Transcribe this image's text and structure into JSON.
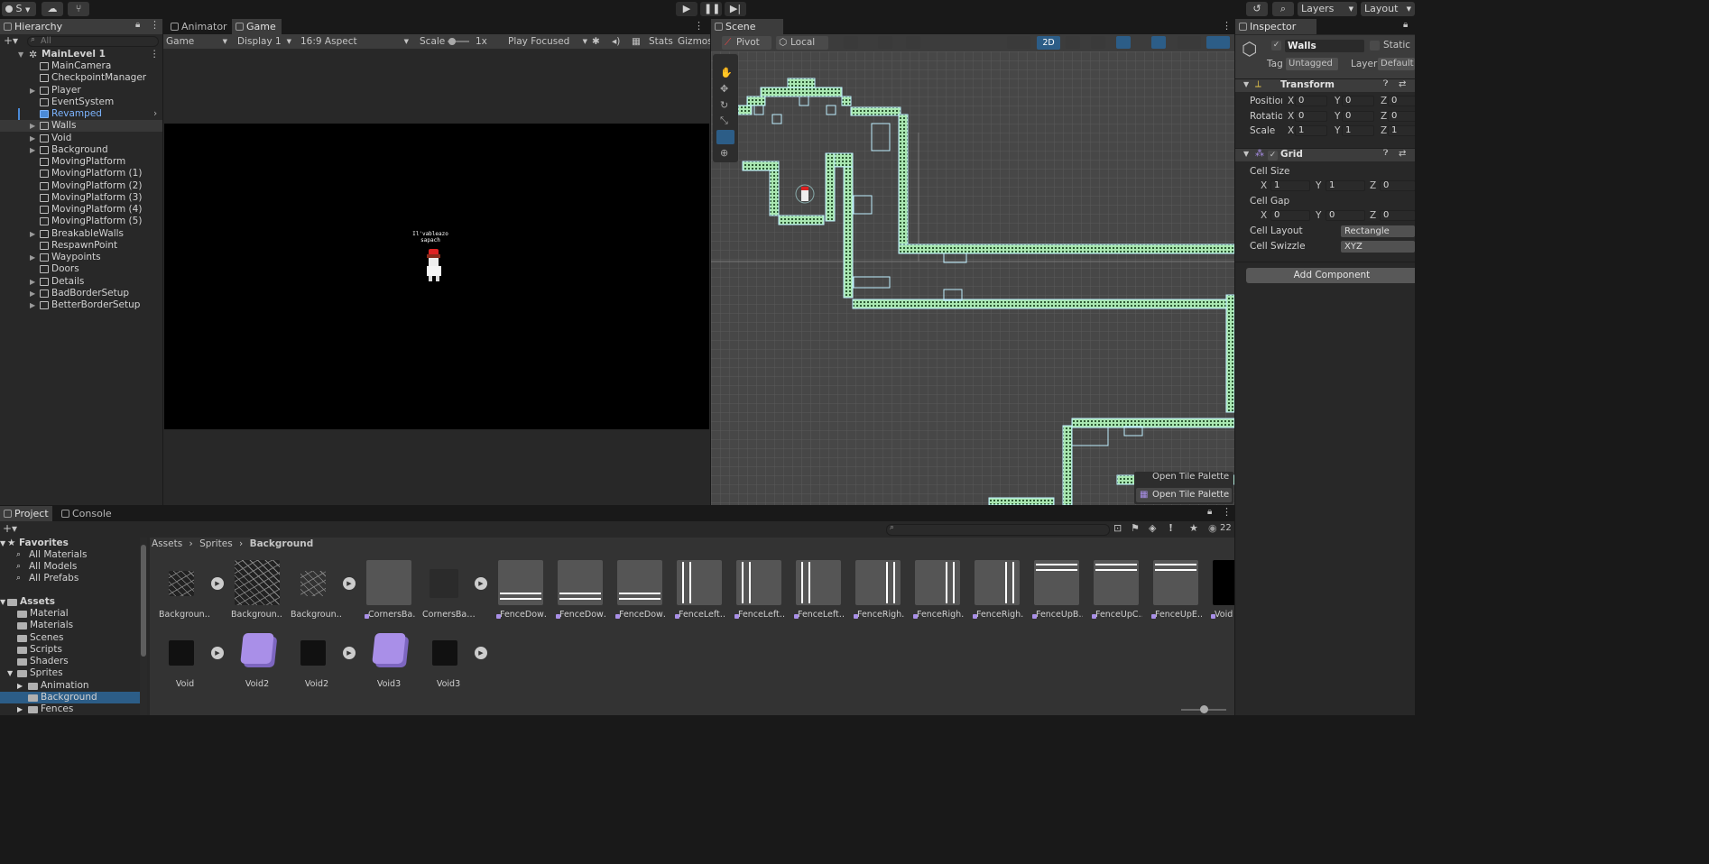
{
  "toolbar": {
    "account_label": "S",
    "layers_label": "Layers",
    "layout_label": "Layout"
  },
  "hierarchy": {
    "tab_label": "Hierarchy",
    "search_placeholder": "All",
    "scene_name": "MainLevel 1",
    "items": [
      {
        "label": "MainCamera",
        "expandable": false,
        "prefab": false
      },
      {
        "label": "CheckpointManager",
        "expandable": false,
        "prefab": false
      },
      {
        "label": "Player",
        "expandable": true,
        "prefab": false
      },
      {
        "label": "EventSystem",
        "expandable": false,
        "prefab": false
      },
      {
        "label": "Revamped",
        "expandable": false,
        "prefab": true
      },
      {
        "label": "Walls",
        "expandable": true,
        "prefab": false,
        "selected": true
      },
      {
        "label": "Void",
        "expandable": true,
        "prefab": false
      },
      {
        "label": "Background",
        "expandable": true,
        "prefab": false
      },
      {
        "label": "MovingPlatform",
        "expandable": false,
        "prefab": false
      },
      {
        "label": "MovingPlatform (1)",
        "expandable": false,
        "prefab": false
      },
      {
        "label": "MovingPlatform (2)",
        "expandable": false,
        "prefab": false
      },
      {
        "label": "MovingPlatform (3)",
        "expandable": false,
        "prefab": false
      },
      {
        "label": "MovingPlatform (4)",
        "expandable": false,
        "prefab": false
      },
      {
        "label": "MovingPlatform (5)",
        "expandable": false,
        "prefab": false
      },
      {
        "label": "BreakableWalls",
        "expandable": true,
        "prefab": false
      },
      {
        "label": "RespawnPoint",
        "expandable": false,
        "prefab": false
      },
      {
        "label": "Waypoints",
        "expandable": true,
        "prefab": false
      },
      {
        "label": "Doors",
        "expandable": false,
        "prefab": false
      },
      {
        "label": "Details",
        "expandable": true,
        "prefab": false
      },
      {
        "label": "BadBorderSetup",
        "expandable": true,
        "prefab": false
      },
      {
        "label": "BetterBorderSetup",
        "expandable": true,
        "prefab": false
      }
    ]
  },
  "game_view": {
    "tabs": [
      "Animator",
      "Game"
    ],
    "mode": "Game",
    "display": "Display 1",
    "aspect": "16:9 Aspect",
    "scale_label": "Scale",
    "scale_value": "1x",
    "play_mode": "Play Focused",
    "stats_label": "Stats",
    "gizmos_label": "Gizmos",
    "speech_text": "Il'vableazo sapach"
  },
  "scene_view": {
    "tab_label": "Scene",
    "pivot_label": "Pivot",
    "local_label": "Local",
    "mode_2d": "2D",
    "open_tile_palette": "Open Tile Palette"
  },
  "inspector": {
    "tab_label": "Inspector",
    "object_name": "Walls",
    "static_label": "Static",
    "tag_label": "Tag",
    "tag_value": "Untagged",
    "layer_label": "Layer",
    "layer_value": "Default",
    "transform": {
      "title": "Transform",
      "position_label": "Position",
      "rotation_label": "Rotation",
      "scale_label": "Scale",
      "position": [
        "0",
        "0",
        "0"
      ],
      "rotation": [
        "0",
        "0",
        "0"
      ],
      "scale": [
        "1",
        "1",
        "1"
      ]
    },
    "grid": {
      "title": "Grid",
      "cell_size_label": "Cell Size",
      "cell_size": [
        "1",
        "1",
        "0"
      ],
      "cell_gap_label": "Cell Gap",
      "cell_gap": [
        "0",
        "0",
        "0"
      ],
      "cell_layout_label": "Cell Layout",
      "cell_layout_value": "Rectangle",
      "cell_swizzle_label": "Cell Swizzle",
      "cell_swizzle_value": "XYZ"
    },
    "add_component_label": "Add Component"
  },
  "project": {
    "tabs": [
      "Project",
      "Console"
    ],
    "count": "22",
    "favorites_label": "Favorites",
    "favorites": [
      "All Materials",
      "All Models",
      "All Prefabs"
    ],
    "assets_label": "Assets",
    "folders": [
      "Material",
      "Materials",
      "Scenes",
      "Scripts",
      "Shaders",
      "Sprites"
    ],
    "sprite_folders": [
      "Animation",
      "Background",
      "Fences"
    ],
    "breadcrumb": [
      "Assets",
      "Sprites",
      "Background"
    ],
    "row1": [
      {
        "name": "Backgroun…",
        "kind": "cracks-small",
        "play": true
      },
      {
        "name": "Backgroun…",
        "kind": "cracks-large",
        "play": false
      },
      {
        "name": "Backgroun…",
        "kind": "cracks-white",
        "play": true
      },
      {
        "name": "CornersBa…",
        "kind": "plain",
        "play": false
      },
      {
        "name": "CornersBa…",
        "kind": "dark",
        "play": true
      },
      {
        "name": "FenceDow…",
        "kind": "fence-bl",
        "play": false
      },
      {
        "name": "FenceDow…",
        "kind": "fence-b",
        "play": false
      },
      {
        "name": "FenceDow…",
        "kind": "fence-br",
        "play": false
      },
      {
        "name": "FenceLeft…",
        "kind": "fence-l",
        "play": false
      },
      {
        "name": "FenceLeft…",
        "kind": "fence-l2",
        "play": false
      },
      {
        "name": "FenceLeft…",
        "kind": "fence-lt",
        "play": false
      },
      {
        "name": "FenceRigh…",
        "kind": "fence-rt",
        "play": false
      },
      {
        "name": "FenceRigh…",
        "kind": "fence-r",
        "play": false
      },
      {
        "name": "FenceRigh…",
        "kind": "fence-rb",
        "play": false
      },
      {
        "name": "FenceUpB…",
        "kind": "fence-tl",
        "play": false
      },
      {
        "name": "FenceUpC…",
        "kind": "fence-t",
        "play": false
      },
      {
        "name": "FenceUpE…",
        "kind": "fence-tr",
        "play": false
      },
      {
        "name": "Void",
        "kind": "black",
        "play": false
      }
    ],
    "row2": [
      {
        "name": "Void",
        "kind": "black-small",
        "play": true
      },
      {
        "name": "Void2",
        "kind": "purple",
        "play": false
      },
      {
        "name": "Void2",
        "kind": "black-small",
        "play": true
      },
      {
        "name": "Void3",
        "kind": "purple",
        "play": false
      },
      {
        "name": "Void3",
        "kind": "black-small",
        "play": true
      }
    ]
  },
  "colors": {
    "accent_blue": "#2c5d87",
    "prefab_blue": "#7cb4ff",
    "tile_green": "#a8e6b0",
    "tile_outline": "#bfefff",
    "grid_bg": "#474747",
    "purple": "#a98fe8"
  }
}
